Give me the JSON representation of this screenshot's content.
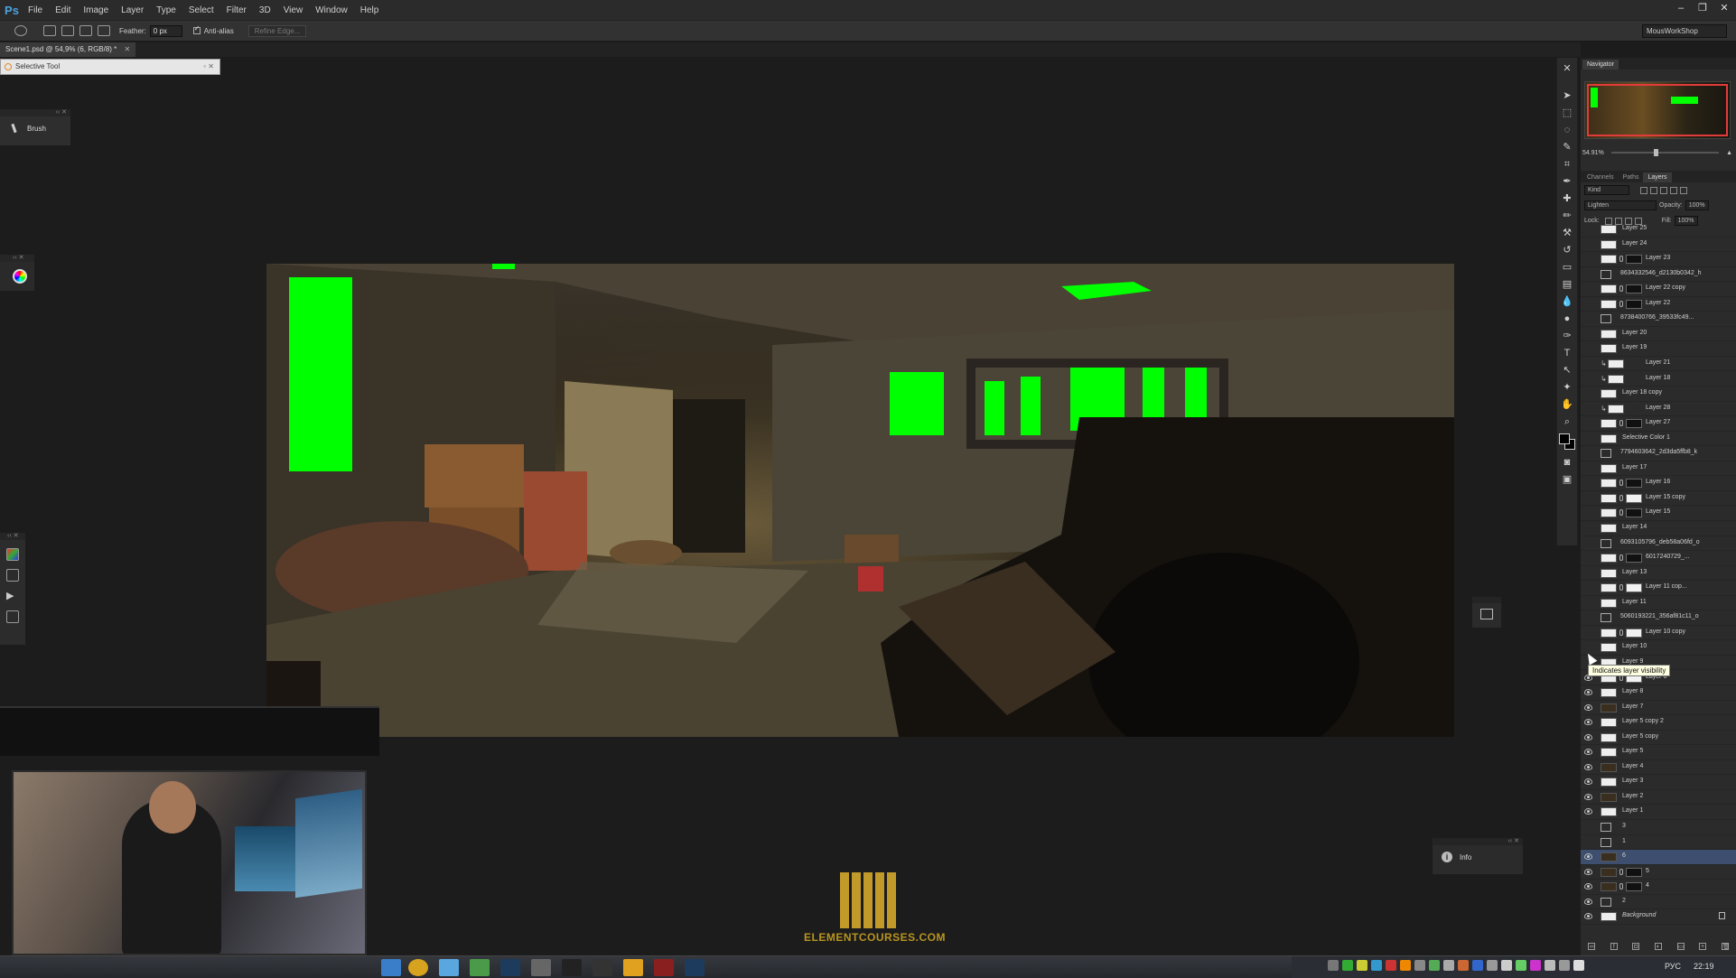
{
  "app": {
    "logo": "Ps",
    "menu": [
      "File",
      "Edit",
      "Image",
      "Layer",
      "Type",
      "Select",
      "Filter",
      "3D",
      "View",
      "Window",
      "Help"
    ],
    "window_controls": [
      "minimize-icon",
      "restore-icon",
      "close-icon"
    ]
  },
  "options": {
    "feather_label": "Feather:",
    "feather_value": "0 px",
    "antialias_label": "Anti-alias",
    "refine_edge_label": "Refine Edge...",
    "workspace": "MousWorkShop"
  },
  "document": {
    "tab_title": "Scene1.psd @ 54,9% (6, RGB/8) *"
  },
  "floating": {
    "selective_tool_title": "Selective Tool",
    "brush_label": "Brush",
    "info_label": "Info"
  },
  "navigator": {
    "title": "Navigator",
    "zoom": "54.91%"
  },
  "layers_panel": {
    "tabs": [
      "Channels",
      "Paths",
      "Layers"
    ],
    "active_tab": "Layers",
    "filter_kind": "Kind",
    "blend_mode": "Lighten",
    "opacity_label": "Opacity:",
    "opacity_value": "100%",
    "lock_label": "Lock:",
    "fill_label": "Fill:",
    "fill_value": "100%",
    "tooltip": "Indicates layer visibility",
    "layers": [
      {
        "name": "Layer 25",
        "type": "normal",
        "visible": false
      },
      {
        "name": "Layer 24",
        "type": "normal",
        "visible": false
      },
      {
        "name": "Layer 23",
        "type": "mask",
        "visible": false
      },
      {
        "name": "8634332546_d2130b0342_h",
        "type": "smart",
        "visible": false
      },
      {
        "name": "Layer 22 copy",
        "type": "mask",
        "visible": false
      },
      {
        "name": "Layer 22",
        "type": "mask",
        "visible": false
      },
      {
        "name": "8738400766_39533fc49...",
        "type": "smart",
        "visible": false
      },
      {
        "name": "Layer 20",
        "type": "normal",
        "visible": false
      },
      {
        "name": "Layer 19",
        "type": "normal",
        "visible": false
      },
      {
        "name": "Layer 21",
        "type": "clip",
        "visible": false
      },
      {
        "name": "Layer 18",
        "type": "clip",
        "visible": false
      },
      {
        "name": "Layer 18 copy",
        "type": "normal",
        "visible": false
      },
      {
        "name": "Layer 28",
        "type": "clip",
        "visible": false
      },
      {
        "name": "Layer 27",
        "type": "mask",
        "visible": false
      },
      {
        "name": "Selective Color 1",
        "type": "adjust",
        "visible": false
      },
      {
        "name": "7794603642_2d3da5ffb8_k",
        "type": "smart",
        "visible": false
      },
      {
        "name": "Layer 17",
        "type": "normal",
        "visible": false
      },
      {
        "name": "Layer 16",
        "type": "mask",
        "visible": false
      },
      {
        "name": "Layer 15 copy",
        "type": "mask",
        "visible": false
      },
      {
        "name": "Layer 15",
        "type": "mask",
        "visible": false
      },
      {
        "name": "Layer 14",
        "type": "normal",
        "visible": false
      },
      {
        "name": "6093105796_deb58a06fd_o",
        "type": "smart",
        "visible": false
      },
      {
        "name": "6017240729_...",
        "type": "mask",
        "visible": false
      },
      {
        "name": "Layer 13",
        "type": "normal",
        "visible": false
      },
      {
        "name": "Layer 11 cop...",
        "type": "mask",
        "visible": false
      },
      {
        "name": "Layer 11",
        "type": "normal",
        "visible": false
      },
      {
        "name": "5060193221_356af81c11_o",
        "type": "smart",
        "visible": false
      },
      {
        "name": "Layer 10 copy",
        "type": "mask",
        "visible": false
      },
      {
        "name": "Layer 10",
        "type": "normal",
        "visible": false
      },
      {
        "name": "Layer 9",
        "type": "normal",
        "visible": false
      },
      {
        "name": "Layer 6",
        "type": "mask",
        "visible": true
      },
      {
        "name": "Layer 8",
        "type": "normal",
        "visible": true
      },
      {
        "name": "Layer 7",
        "type": "dark",
        "visible": true
      },
      {
        "name": "Layer 5 copy 2",
        "type": "normal",
        "visible": true
      },
      {
        "name": "Layer 5 copy",
        "type": "normal",
        "visible": true
      },
      {
        "name": "Layer 5",
        "type": "normal",
        "visible": true
      },
      {
        "name": "Layer 4",
        "type": "dark",
        "visible": true
      },
      {
        "name": "Layer 3",
        "type": "normal",
        "visible": true
      },
      {
        "name": "Layer 2",
        "type": "dark",
        "visible": true
      },
      {
        "name": "Layer 1",
        "type": "normal",
        "visible": true
      },
      {
        "name": "3",
        "type": "group",
        "visible": false
      },
      {
        "name": "1",
        "type": "group",
        "visible": false
      },
      {
        "name": "6",
        "type": "selected",
        "visible": true
      },
      {
        "name": "5",
        "type": "darkmask",
        "visible": true
      },
      {
        "name": "4",
        "type": "darkmask",
        "visible": true
      },
      {
        "name": "2",
        "type": "group",
        "visible": true
      },
      {
        "name": "Background",
        "type": "background",
        "visible": true
      }
    ]
  },
  "watermark": {
    "text": "ELEMENTCOURSES.COM"
  },
  "taskbar": {
    "language": "РУС",
    "clock": "22:19"
  },
  "colors": {
    "chroma_green": "#00ff00",
    "selection_red": "#e23b3b",
    "watermark_gold": "#c19a2a",
    "selected_layer": "#3d4e6e"
  }
}
